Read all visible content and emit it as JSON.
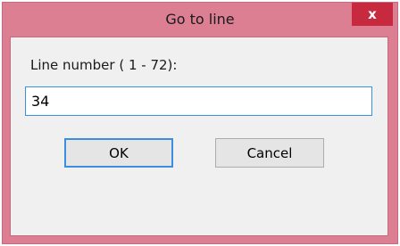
{
  "dialog": {
    "title": "Go to line",
    "close_glyph": "x",
    "close_icon": "close-icon",
    "field_label": "Line number ( 1 - 72):",
    "input_value": "34",
    "ok_label": "OK",
    "cancel_label": "Cancel",
    "colors": {
      "frame": "#dc7f93",
      "close_button": "#c7293f",
      "client_background": "#f0f0f0",
      "focus_border": "#3c8ee0"
    }
  }
}
